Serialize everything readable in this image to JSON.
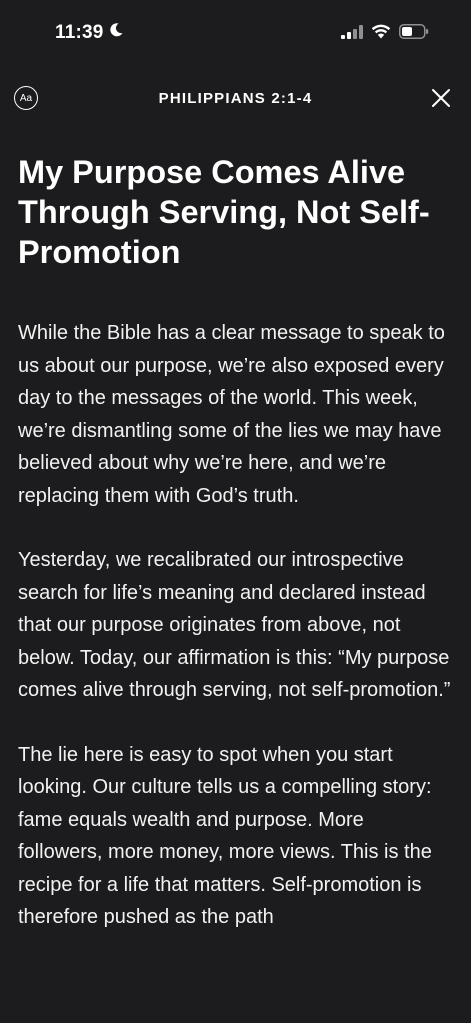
{
  "status_bar": {
    "time": "11:39",
    "moon_icon": "moon-icon",
    "signal_icon": "cellular-signal-icon",
    "wifi_icon": "wifi-icon",
    "battery_icon": "battery-icon"
  },
  "nav": {
    "font_button_label": "Aa",
    "title": "PHILIPPIANS 2:1-4",
    "close_icon": "close-icon"
  },
  "article": {
    "headline": "My Purpose Comes Alive Through Serving, Not Self-Promotion",
    "paragraphs": [
      "While the Bible has a clear message to speak to us about our purpose, we’re also exposed every day to the messages of the world. This week, we’re dismantling some of the lies we may have believed about why we’re here, and we’re replacing them with God’s truth.",
      "Yesterday, we recalibrated our introspective search for life’s meaning and declared instead that our purpose originates from above, not below. Today, our affirmation is this: “My purpose comes alive through serving, not self-promotion.”",
      "The lie here is easy to spot when you start looking. Our culture tells us a compelling story: fame equals wealth and purpose. More followers, more money, more views. This is the recipe for a life that matters. Self-promotion is therefore pushed as the path"
    ]
  },
  "colors": {
    "background": "#1c1c1e",
    "text": "#ffffff"
  }
}
